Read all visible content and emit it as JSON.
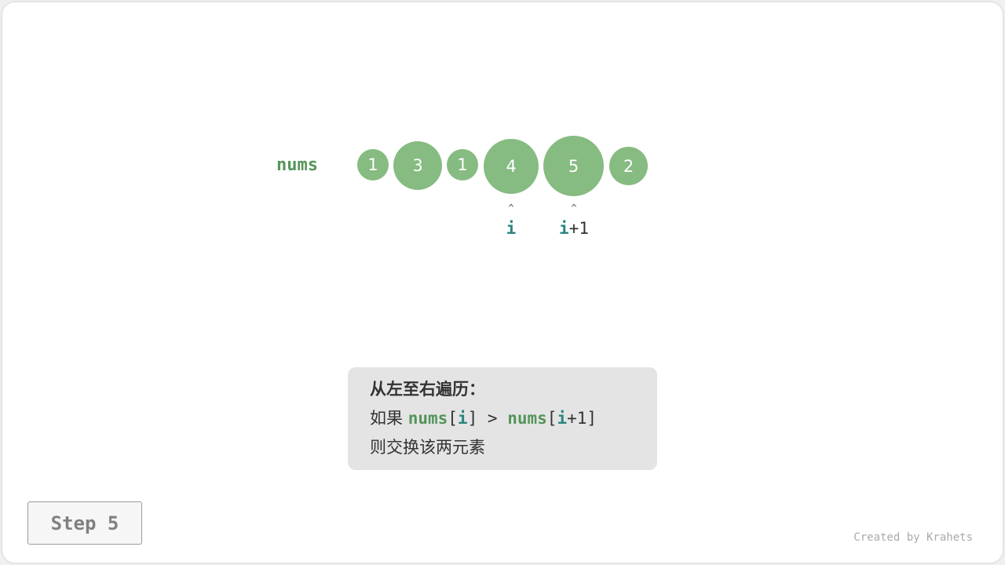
{
  "array": {
    "label": "nums",
    "elements": [
      {
        "value": "1"
      },
      {
        "value": "3"
      },
      {
        "value": "1"
      },
      {
        "value": "4"
      },
      {
        "value": "5"
      },
      {
        "value": "2"
      }
    ]
  },
  "pointers": {
    "i": {
      "var": "i",
      "suffix": "",
      "index": 3
    },
    "i_plus_1": {
      "var": "i",
      "suffix": "+1",
      "index": 4
    }
  },
  "info": {
    "title": "从左至右遍历：",
    "cond_prefix": "如果",
    "cond_nums1": "nums",
    "cond_lbr1": "[",
    "cond_i1": "i",
    "cond_rbr1": "]",
    "cond_gt": ">",
    "cond_nums2": "nums",
    "cond_lbr2": "[",
    "cond_i2": "i",
    "cond_plus": "+1",
    "cond_rbr2": "]",
    "action": "则交换该两元素"
  },
  "step_label": "Step 5",
  "credit": "Created by Krahets",
  "colors": {
    "circle": "#86bb81",
    "nums_label": "#55955a",
    "pointer_var": "#2a8680",
    "info_bg": "#e4e4e4"
  }
}
